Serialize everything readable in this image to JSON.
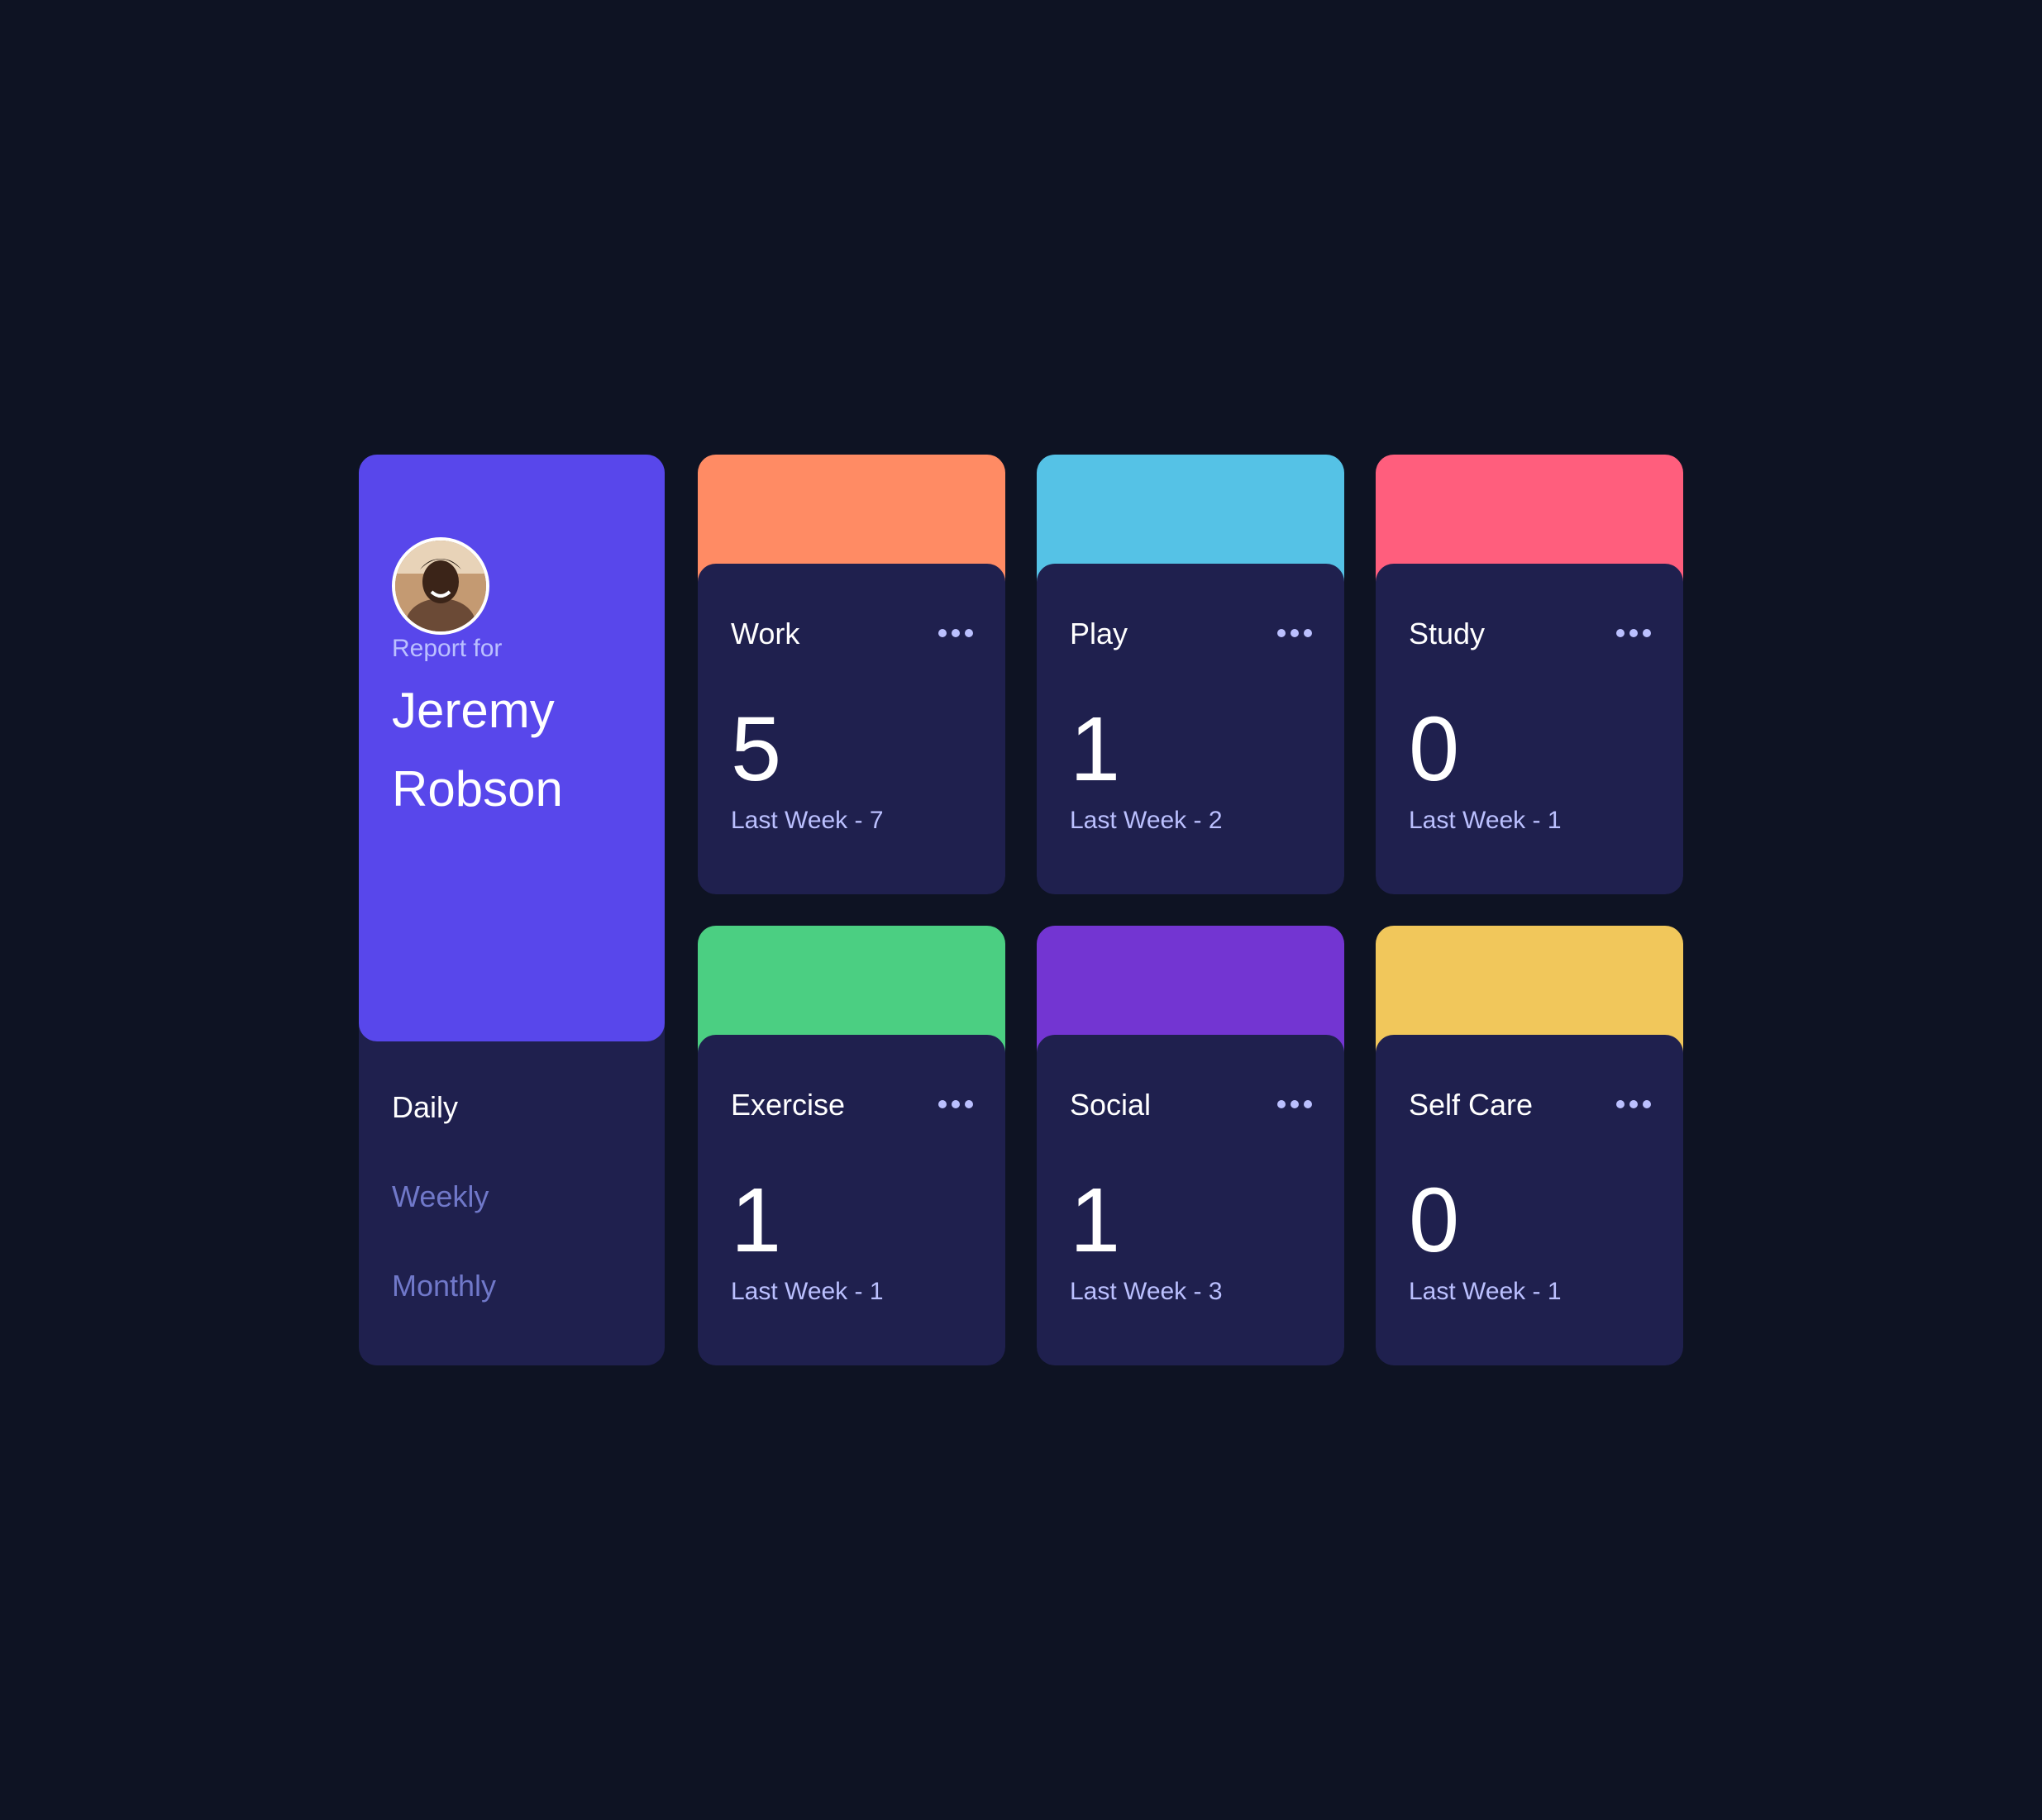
{
  "profile": {
    "report_for": "Report for",
    "name": "Jeremy Robson",
    "avatar_icon": "user-avatar-photo"
  },
  "periods": [
    {
      "label": "Daily",
      "active": true
    },
    {
      "label": "Weekly",
      "active": false
    },
    {
      "label": "Monthly",
      "active": false
    }
  ],
  "activities": [
    {
      "title": "Work",
      "current": "5",
      "previous": "Last Week - 7",
      "color": "#ff8b64",
      "icon": "briefcase-icon"
    },
    {
      "title": "Play",
      "current": "1",
      "previous": "Last Week - 2",
      "color": "#55c2e6",
      "icon": "gamepad-icon"
    },
    {
      "title": "Study",
      "current": "0",
      "previous": "Last Week - 1",
      "color": "#ff5e7d",
      "icon": "book-icon"
    },
    {
      "title": "Exercise",
      "current": "1",
      "previous": "Last Week - 1",
      "color": "#4bcf82",
      "icon": "running-icon"
    },
    {
      "title": "Social",
      "current": "1",
      "previous": "Last Week - 3",
      "color": "#7335d2",
      "icon": "chat-icon"
    },
    {
      "title": "Self Care",
      "current": "0",
      "previous": "Last Week - 1",
      "color": "#f1c75b",
      "icon": "heart-icon"
    }
  ],
  "colors": {
    "background": "#0e1323",
    "card": "#1f204e",
    "accent": "#5847eb",
    "muted_text": "#bbc0ff",
    "inactive_period": "#7078c9"
  }
}
